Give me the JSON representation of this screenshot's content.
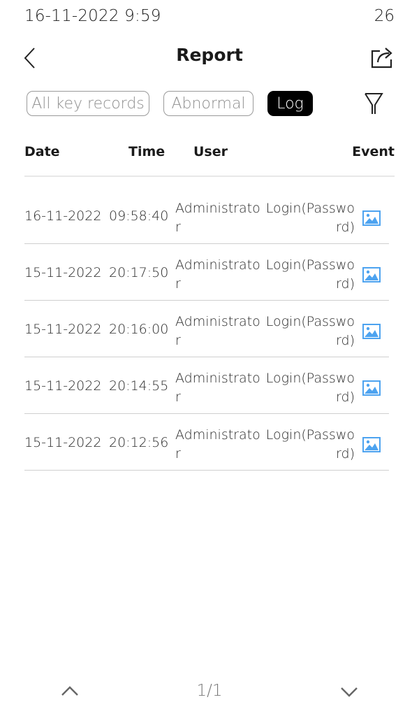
{
  "status_bar": {
    "datetime": "16-11-2022  9:59",
    "indicator": "26"
  },
  "header": {
    "title": "Report",
    "back_icon": "chevron-left-icon",
    "share_icon": "share-export-icon"
  },
  "tabs": [
    {
      "label": "All key records",
      "active": false
    },
    {
      "label": "Abnormal",
      "active": false
    },
    {
      "label": "Log",
      "active": true
    }
  ],
  "filter_icon": "filter-funnel-icon",
  "columns": {
    "date": "Date",
    "time": "Time",
    "user": "User",
    "event": "Event"
  },
  "rows": [
    {
      "date": "16-11-2022",
      "time": "09:58:40",
      "user": "Administrator",
      "event": "Login(Password)",
      "icon": "image-icon"
    },
    {
      "date": "15-11-2022",
      "time": "20:17:50",
      "user": "Administrator",
      "event": "Login(Password)",
      "icon": "image-icon"
    },
    {
      "date": "15-11-2022",
      "time": "20:16:00",
      "user": "Administrator",
      "event": "Login(Password)",
      "icon": "image-icon"
    },
    {
      "date": "15-11-2022",
      "time": "20:14:55",
      "user": "Administrator",
      "event": "Login(Password)",
      "icon": "image-icon"
    },
    {
      "date": "15-11-2022",
      "time": "20:12:56",
      "user": "Administrator",
      "event": "Login(Password)",
      "icon": "image-icon"
    }
  ],
  "pager": {
    "page": "1/1",
    "prev_icon": "chevron-up-icon",
    "next_icon": "chevron-down-icon"
  },
  "colors": {
    "accent_icon": "#4da3f0",
    "active_tab_bg": "#000000",
    "divider": "#cfcfcf"
  }
}
